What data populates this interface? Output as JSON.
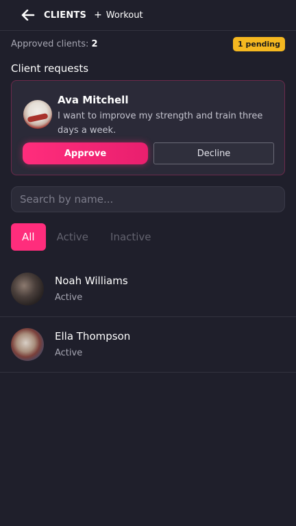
{
  "header": {
    "back_icon": "arrow-left-icon",
    "title": "CLIENTS",
    "workout_plus": "+",
    "workout_label": "Workout"
  },
  "summary": {
    "approved_label": "Approved clients:",
    "approved_count": "2",
    "pending_badge": "1 pending"
  },
  "requests": {
    "section_title": "Client requests",
    "items": [
      {
        "name": "Ava Mitchell",
        "message": "I want to improve my strength and train three days a week.",
        "approve_label": "Approve",
        "decline_label": "Decline"
      }
    ]
  },
  "search": {
    "placeholder": "Search by name..."
  },
  "filters": {
    "items": [
      "All",
      "Active",
      "Inactive"
    ],
    "selected": "All"
  },
  "clients": [
    {
      "name": "Noah Williams",
      "status": "Active"
    },
    {
      "name": "Ella Thompson",
      "status": "Active"
    }
  ],
  "colors": {
    "background": "#1f1f2b",
    "accent": "#ff2d7c",
    "badge": "#f5b820"
  }
}
